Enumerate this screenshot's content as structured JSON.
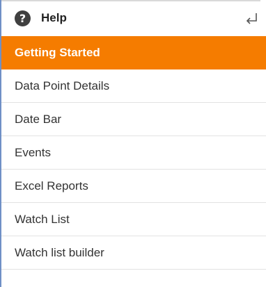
{
  "header": {
    "title": "Help",
    "help_icon": "question-circle-icon",
    "help_glyph": "?",
    "return_icon": "return-arrow-icon"
  },
  "menu": {
    "active_index": 0,
    "items": [
      {
        "label": "Getting Started"
      },
      {
        "label": "Data Point Details"
      },
      {
        "label": "Date Bar"
      },
      {
        "label": "Events"
      },
      {
        "label": "Excel Reports"
      },
      {
        "label": "Watch List"
      },
      {
        "label": "Watch list builder"
      }
    ]
  },
  "colors": {
    "active_background": "#f57c00",
    "active_text": "#ffffff",
    "border_left": "#6f90c6",
    "icon_dark": "#404040"
  }
}
